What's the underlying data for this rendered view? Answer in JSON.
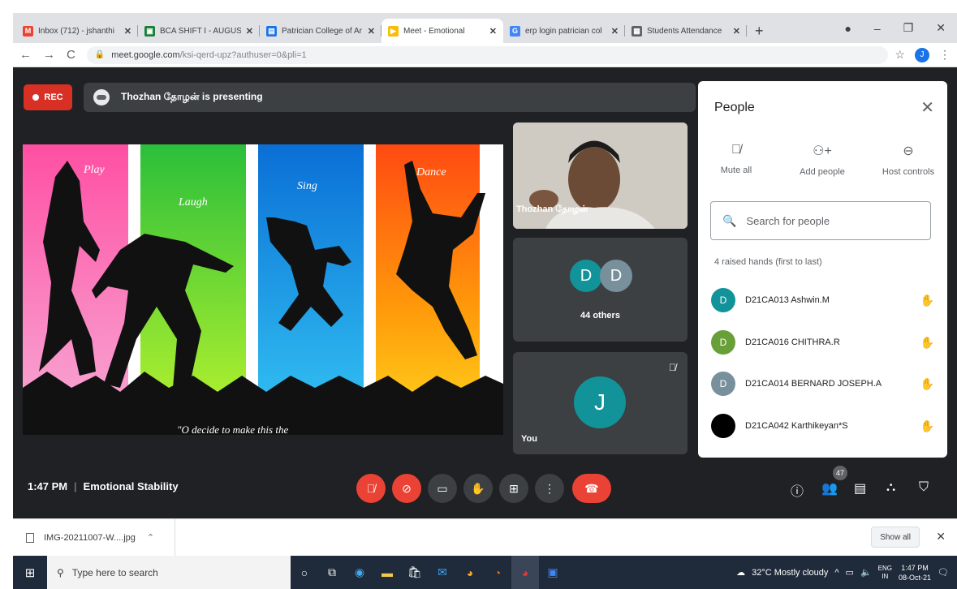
{
  "browser": {
    "tabs": [
      {
        "title": "Inbox (712) - jshanthi",
        "icon": "gmail-icon",
        "color": "#ea4335",
        "glyph": "M",
        "active": false
      },
      {
        "title": "BCA SHIFT I - AUGUST",
        "icon": "classroom-icon",
        "color": "#188038",
        "glyph": "▣",
        "active": false
      },
      {
        "title": "Patrician College of Ar",
        "icon": "doc-icon",
        "color": "#1a73e8",
        "glyph": "▤",
        "active": false
      },
      {
        "title": "Meet - Emotional",
        "icon": "meet-icon",
        "color": "#fbbc04",
        "glyph": "▶",
        "active": true
      },
      {
        "title": "erp login patrician col",
        "icon": "google-icon",
        "color": "#4285f4",
        "glyph": "G",
        "active": false
      },
      {
        "title": "Students Attendance",
        "icon": "sheet-icon",
        "color": "#5f6368",
        "glyph": "▦",
        "active": false
      }
    ],
    "new_tab": "+",
    "url": "meet.google.com/ksi-qerd-upz?authuser=0&pli=1",
    "url_host": "meet.google.com",
    "url_path": "/ksi-qerd-upz?authuser=0&pli=1",
    "profile_initial": "J"
  },
  "meet": {
    "rec_label": "REC",
    "presenting_text": "Thozhan தோழன் is presenting",
    "slide_words": [
      "Play",
      "Laugh",
      "Sing",
      "Dance"
    ],
    "slide_caption": "\"O decide to make this the",
    "presenter_name": "Thozhan தோழன்",
    "others_initials": [
      "D",
      "D"
    ],
    "others_label": "44 others",
    "self_initial": "J",
    "self_label": "You",
    "time": "1:47 PM",
    "meeting_title": "Emotional Stability",
    "participant_count": "47"
  },
  "people": {
    "title": "People",
    "actions": [
      {
        "label": "Mute all",
        "icon": "mute-all-icon",
        "glyph": "🎙"
      },
      {
        "label": "Add people",
        "icon": "add-person-icon",
        "glyph": "👤+"
      },
      {
        "label": "Host controls",
        "icon": "host-controls-icon",
        "glyph": "⊖"
      }
    ],
    "search_placeholder": "Search for people",
    "raised_hands_label": "4 raised hands (first to last)",
    "raised": [
      {
        "initial": "D",
        "name": "D21CA013 Ashwin.M",
        "color": "#12939a"
      },
      {
        "initial": "D",
        "name": "D21CA016 CHITHRA.R",
        "color": "#689f38"
      },
      {
        "initial": "D",
        "name": "D21CA014 BERNARD JOSEPH.A",
        "color": "#78909c"
      },
      {
        "initial": "",
        "name": "D21CA042 Karthikeyan*S",
        "color": "#000000"
      }
    ]
  },
  "download": {
    "file": "IMG-20211007-W....jpg",
    "show_all": "Show all"
  },
  "taskbar": {
    "search_placeholder": "Type here to search",
    "weather": "32°C  Mostly cloudy",
    "lang_top": "ENG",
    "lang_bottom": "IN",
    "time": "1:47 PM",
    "date": "08-Oct-21"
  }
}
